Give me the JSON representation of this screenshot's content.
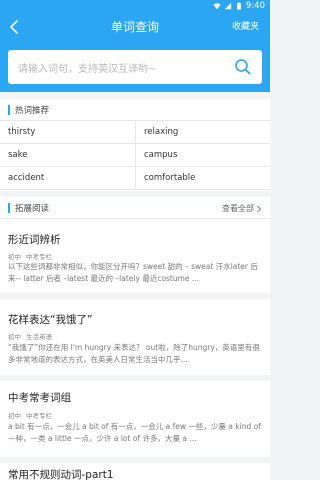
{
  "status_bar": {
    "time": "9:40"
  },
  "header": {
    "title": "单词查询",
    "favorites_label": "收藏夹"
  },
  "search": {
    "placeholder": "请输入词句，支持英汉互译哟~"
  },
  "hot_words": {
    "title": "热词推荐",
    "items": [
      "thirsty",
      "relaxing",
      "sake",
      "campus",
      "accident",
      "comfortable"
    ]
  },
  "extended_reading": {
    "title": "拓展阅读",
    "view_all": "查看全部",
    "articles": [
      {
        "title": "形近词辨析",
        "tags": [
          "初中",
          "中考专栏"
        ],
        "excerpt": "以下这些词都非常相似，你能区分开吗？sweet 甜的 – sweat 汗水later 后来-- latter 后者 –latest 最近的 –lately 最近costume ..."
      },
      {
        "title": "花样表达“我饿了”",
        "tags": [
          "初中",
          "生活英语"
        ],
        "excerpt": "“我饿了”你还在用 I'm hungry 来表达？ out啦，除了hungry，英语里有很多非常地道的表达方式，在英美人日常生活当中几乎..."
      },
      {
        "title": "中考常考词组",
        "tags": [
          "初中",
          "中考专栏"
        ],
        "excerpt": "a bit 有一点，一会儿 a bit of 有一点，一会儿 a few 一些，少量 a kind of—种，一类 a little 一点，少许 a lot of 许多，大量 a ..."
      },
      {
        "title": "常用不规则动词-part1",
        "tags": [],
        "excerpt": ""
      }
    ]
  },
  "colors": {
    "primary": "#2aa6f2",
    "background": "#f2f4f6"
  }
}
